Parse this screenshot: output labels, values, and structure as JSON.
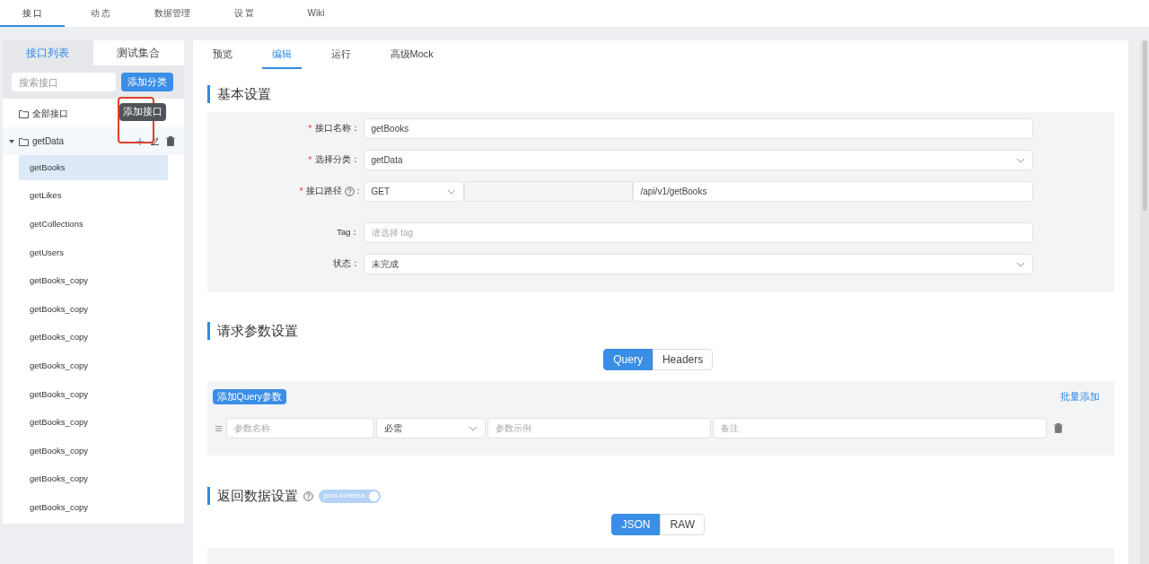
{
  "top_nav": [
    {
      "label": "接 口",
      "selected": true
    },
    {
      "label": "动 态",
      "selected": false
    },
    {
      "label": "数据管理",
      "selected": false
    },
    {
      "label": "设 置",
      "selected": false
    },
    {
      "label": "Wiki",
      "selected": false
    }
  ],
  "sidebar": {
    "tabs": [
      {
        "label": "接口列表",
        "selected": true
      },
      {
        "label": "测试集合",
        "selected": false
      }
    ],
    "search": {
      "placeholder": "搜索接口"
    },
    "add_button": "添加分类",
    "all_label": "全部接口",
    "tooltip": "添加接口",
    "tree": [
      {
        "label": "getData",
        "expanded": true,
        "children": [
          {
            "label": "getBooks",
            "selected": true
          },
          {
            "label": "getLikes",
            "selected": false
          },
          {
            "label": "getCollections",
            "selected": false
          },
          {
            "label": "getUsers",
            "selected": false
          },
          {
            "label": "getBooks_copy",
            "selected": false
          },
          {
            "label": "getBooks_copy",
            "selected": false
          },
          {
            "label": "getBooks_copy",
            "selected": false
          },
          {
            "label": "getBooks_copy",
            "selected": false
          },
          {
            "label": "getBooks_copy",
            "selected": false
          },
          {
            "label": "getBooks_copy",
            "selected": false
          },
          {
            "label": "getBooks_copy",
            "selected": false
          },
          {
            "label": "getBooks_copy",
            "selected": false
          },
          {
            "label": "getBooks_copy",
            "selected": false
          }
        ]
      }
    ]
  },
  "main_tabs": [
    {
      "label": "预览",
      "selected": false
    },
    {
      "label": "编辑",
      "selected": true
    },
    {
      "label": "运行",
      "selected": false
    },
    {
      "label": "高级Mock",
      "selected": false
    }
  ],
  "basic": {
    "title": "基本设置",
    "name": {
      "label": "接口名称：",
      "mark": "*",
      "value": "getBooks"
    },
    "category": {
      "label": "选择分类：",
      "mark": "*",
      "value": "getData"
    },
    "path": {
      "label": "接口路径",
      "colon": ":",
      "mark": "*",
      "method": "GET",
      "value": "/api/v1/getBooks"
    },
    "tag": {
      "label": "Tag：",
      "placeholder": "请选择 tag"
    },
    "status": {
      "label": "状态：",
      "value": "未完成"
    }
  },
  "request": {
    "title": "请求参数设置",
    "tabs": [
      {
        "label": "Query",
        "selected": true
      },
      {
        "label": "Headers",
        "selected": false
      }
    ],
    "add_button": "添加Query参数",
    "batch_add": "批量添加",
    "row": {
      "name_placeholder": "参数名称",
      "required": "必需",
      "example_placeholder": "参数示例",
      "note_placeholder": "备注"
    }
  },
  "response": {
    "title": "返回数据设置",
    "switch": {
      "label": "json-schema",
      "on": true
    },
    "tabs": [
      {
        "label": "JSON",
        "selected": true
      },
      {
        "label": "RAW",
        "selected": false
      }
    ]
  }
}
